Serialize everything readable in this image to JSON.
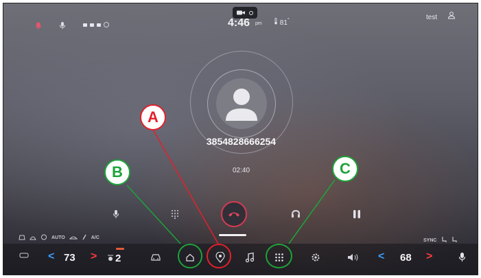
{
  "status_bar": {
    "time": "4:46",
    "ampm": "pm",
    "outside_temp": "81",
    "user_name": "test"
  },
  "call": {
    "phone_number": "3854828666254",
    "duration": "02:40"
  },
  "climate": {
    "auto_label": "AUTO",
    "ac_label": "A/C",
    "sync_label": "SYNC",
    "driver_temp": "73",
    "passenger_temp": "68",
    "fan_level": "2"
  },
  "callouts": {
    "a": "A",
    "b": "B",
    "c": "C"
  },
  "colors": {
    "end_call_ring": "#d83b52",
    "temp_down_arrow": "#3aa0ff",
    "temp_up_arrow": "#ff3b3b",
    "annotation_red": "#e3202b",
    "annotation_green": "#1ea33a"
  },
  "icons": {
    "top_bar": [
      "notification-icon",
      "microphone-icon",
      "status-indicators",
      "camera-icon",
      "thermometer-icon",
      "user-icon"
    ],
    "call_controls": [
      "microphone-icon",
      "keypad-icon",
      "end-call-icon",
      "transfer-audio-icon",
      "pause-icon"
    ],
    "dock": [
      "seat-heat-icon",
      "fan-icon",
      "car-icon",
      "home-icon",
      "location-pin-icon",
      "music-note-icon",
      "app-grid-icon",
      "settings-gear-icon",
      "volume-icon",
      "voice-microphone-icon"
    ]
  }
}
